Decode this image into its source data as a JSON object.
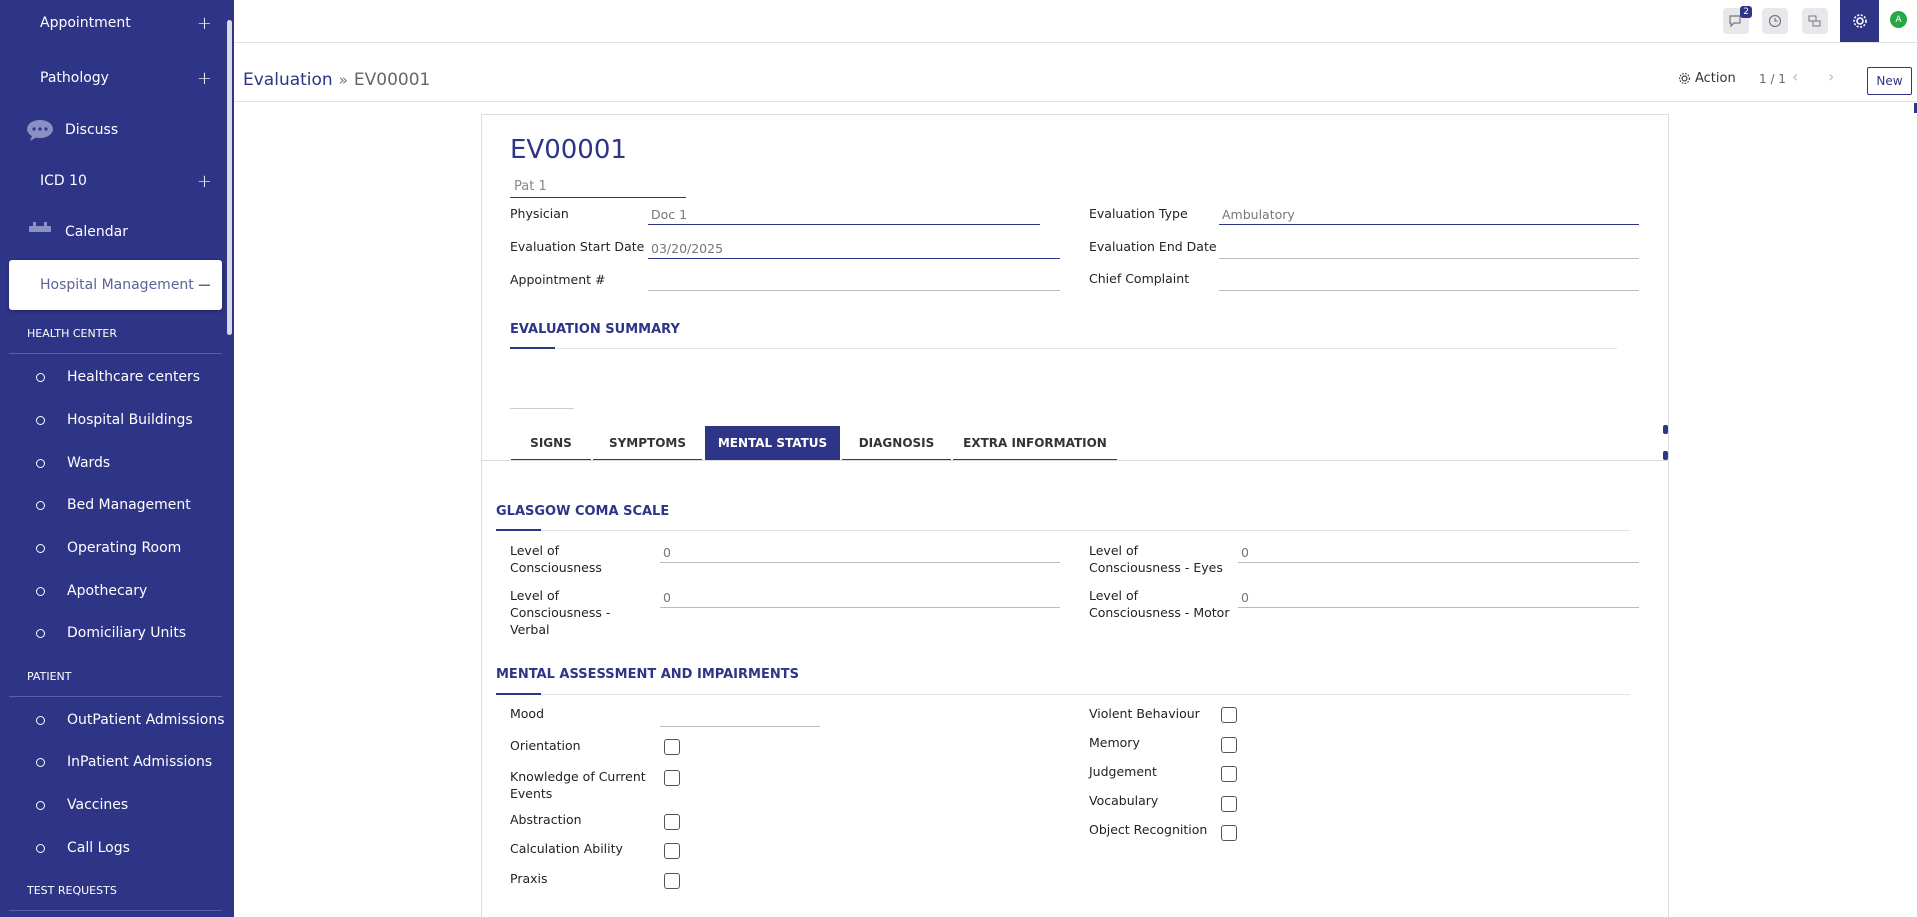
{
  "sidebar": {
    "menus": [
      {
        "label": "Appointment",
        "expander": "+"
      },
      {
        "label": "Pathology",
        "expander": "+"
      },
      {
        "label": "Discuss"
      },
      {
        "label": "ICD 10",
        "expander": "+"
      },
      {
        "label": "Calendar"
      },
      {
        "label": "Hospital Management",
        "expander": "−"
      }
    ],
    "sections": [
      {
        "title": "HEALTH CENTER",
        "items": [
          "Healthcare centers",
          "Hospital Buildings",
          "Wards",
          "Bed Management",
          "Operating Room",
          "Apothecary",
          "Domiciliary Units"
        ]
      },
      {
        "title": "PATIENT",
        "items": [
          "OutPatient Admissions",
          "InPatient Admissions",
          "Vaccines",
          "Call Logs"
        ]
      },
      {
        "title": "TEST REQUESTS",
        "items": []
      }
    ]
  },
  "topbar": {
    "messages_badge": "2",
    "avatar_letter": "A",
    "icons": [
      "chat-icon",
      "clock-icon",
      "activity-icon",
      "gear-icon",
      "avatar"
    ]
  },
  "control_panel": {
    "breadcrumb_parent": "Evaluation",
    "breadcrumb_separator": "»",
    "breadcrumb_current": "EV00001",
    "action_label": "Action",
    "pager": "1 / 1",
    "new_label": "New"
  },
  "form": {
    "title": "EV00001",
    "patient": "Pat 1",
    "physician_label": "Physician",
    "physician_value": "Doc 1",
    "start_date_label": "Evaluation Start Date",
    "start_date_value": "03/20/2025",
    "appointment_label": "Appointment #",
    "appointment_value": "",
    "eval_type_label": "Evaluation Type",
    "eval_type_value": "Ambulatory",
    "end_date_label": "Evaluation End Date",
    "end_date_value": "",
    "chief_complaint_label": "Chief Complaint",
    "chief_complaint_value": "",
    "summary_title": "EVALUATION SUMMARY",
    "tabs": [
      "SIGNS",
      "SYMPTOMS",
      "MENTAL STATUS",
      "DIAGNOSIS",
      "EXTRA INFORMATION"
    ],
    "active_tab": "MENTAL STATUS",
    "gcs_title": "GLASGOW COMA SCALE",
    "gcs": {
      "loc_label_1": "Level of",
      "loc_label_2": "Consciousness",
      "loc_value": "0",
      "eyes_label_1": "Level of",
      "eyes_label_2": "Consciousness - Eyes",
      "eyes_value": "0",
      "verbal_label_1": "Level of",
      "verbal_label_2": "Consciousness -",
      "verbal_label_3": "Verbal",
      "verbal_value": "0",
      "motor_label_1": "Level of",
      "motor_label_2": "Consciousness - Motor",
      "motor_value": "0"
    },
    "mental_title": "MENTAL ASSESSMENT AND IMPAIRMENTS",
    "mental": {
      "mood_label": "Mood",
      "mood_value": "",
      "orientation": "Orientation",
      "knowledge_1": "Knowledge of Current",
      "knowledge_2": "Events",
      "abstraction": "Abstraction",
      "calculation": "Calculation Ability",
      "praxis": "Praxis",
      "violent": "Violent Behaviour",
      "memory": "Memory",
      "judgement": "Judgement",
      "vocabulary": "Vocabulary",
      "object_recognition": "Object Recognition"
    }
  },
  "colors": {
    "primary": "#2e3486",
    "avatar": "#27a745"
  }
}
